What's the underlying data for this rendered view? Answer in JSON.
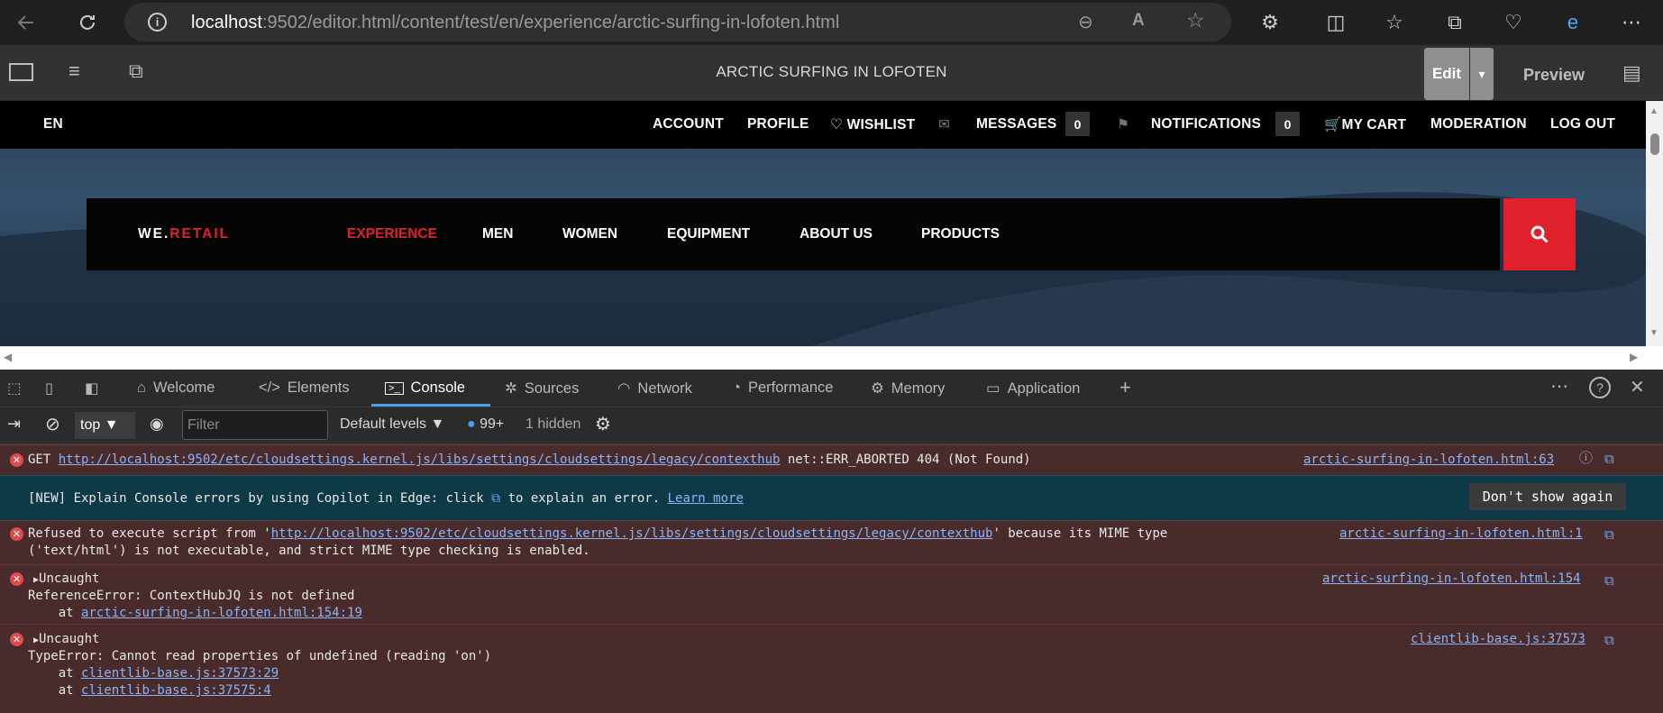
{
  "browser": {
    "url_host": "localhost",
    "url_rest": ":9502/editor.html/content/test/en/experience/arctic-surfing-in-lofoten.html"
  },
  "editor": {
    "page_title": "ARCTIC SURFING IN LOFOTEN",
    "edit_label": "Edit",
    "preview_label": "Preview"
  },
  "site": {
    "language": "EN",
    "top_nav": {
      "account": "ACCOUNT",
      "profile": "PROFILE",
      "wishlist": "WISHLIST",
      "messages": "MESSAGES",
      "messages_count": "0",
      "notifications": "NOTIFICATIONS",
      "notifications_count": "0",
      "cart": "MY CART",
      "moderation": "MODERATION",
      "logout": "LOG OUT"
    },
    "logo_prefix": "WE.",
    "logo_suffix": "RETAIL",
    "main_nav": [
      "EXPERIENCE",
      "MEN",
      "WOMEN",
      "EQUIPMENT",
      "ABOUT US",
      "PRODUCTS"
    ],
    "colors": {
      "accent": "#e0202a"
    }
  },
  "devtools": {
    "tabs": [
      "Welcome",
      "Elements",
      "Console",
      "Sources",
      "Network",
      "Performance",
      "Memory",
      "Application"
    ],
    "active_tab": "Console",
    "context": "top",
    "filter_placeholder": "Filter",
    "levels": "Default levels",
    "issues_count": "99+",
    "hidden": "1 hidden"
  },
  "console": {
    "m1": {
      "prefix": "GET ",
      "url": "http://localhost:9502/etc/cloudsettings.kernel.js/libs/settings/cloudsettings/legacy/contexthub",
      "suffix": " net::ERR_ABORTED 404 (Not Found)",
      "source": "arctic-surfing-in-lofoten.html:63"
    },
    "m2": {
      "before": "[NEW] Explain Console errors by using Copilot in Edge: click ",
      "after": " to explain an error. ",
      "link": "Learn more",
      "button": "Don't show again"
    },
    "m3": {
      "line1a": "Refused to execute script from '",
      "url": "http://localhost:9502/etc/cloudsettings.kernel.js/libs/settings/cloudsettings/legacy/contexthub",
      "line1b": "' because its MIME type",
      "line2": "('text/html') is not executable, and strict MIME type checking is enabled.",
      "source": "arctic-surfing-in-lofoten.html:1"
    },
    "m4": {
      "head": "Uncaught",
      "line2": "ReferenceError: ContextHubJQ is not defined",
      "at": "    at ",
      "at_link": "arctic-surfing-in-lofoten.html:154:19",
      "source": "arctic-surfing-in-lofoten.html:154"
    },
    "m5": {
      "head": "Uncaught",
      "line2": "TypeError: Cannot read properties of undefined (reading 'on')",
      "at": "    at ",
      "at_link1": "clientlib-base.js:37573:29",
      "at_link2": "clientlib-base.js:37575:4",
      "source": "clientlib-base.js:37573"
    }
  }
}
